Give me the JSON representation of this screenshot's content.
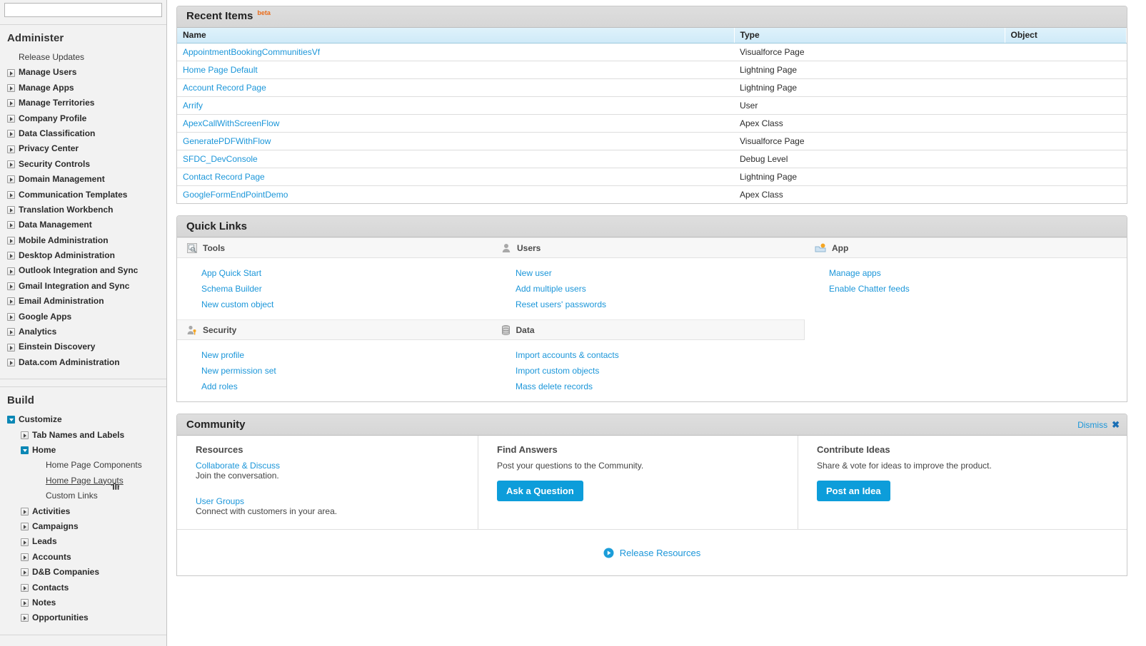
{
  "sidebar": {
    "search_placeholder": "",
    "administer": {
      "title": "Administer",
      "items": [
        {
          "label": "Release Updates",
          "state": "leaf"
        },
        {
          "label": "Manage Users",
          "state": "closed"
        },
        {
          "label": "Manage Apps",
          "state": "closed"
        },
        {
          "label": "Manage Territories",
          "state": "closed"
        },
        {
          "label": "Company Profile",
          "state": "closed"
        },
        {
          "label": "Data Classification",
          "state": "closed"
        },
        {
          "label": "Privacy Center",
          "state": "closed"
        },
        {
          "label": "Security Controls",
          "state": "closed"
        },
        {
          "label": "Domain Management",
          "state": "closed"
        },
        {
          "label": "Communication Templates",
          "state": "closed"
        },
        {
          "label": "Translation Workbench",
          "state": "closed"
        },
        {
          "label": "Data Management",
          "state": "closed"
        },
        {
          "label": "Mobile Administration",
          "state": "closed"
        },
        {
          "label": "Desktop Administration",
          "state": "closed"
        },
        {
          "label": "Outlook Integration and Sync",
          "state": "closed"
        },
        {
          "label": "Gmail Integration and Sync",
          "state": "closed"
        },
        {
          "label": "Email Administration",
          "state": "closed"
        },
        {
          "label": "Google Apps",
          "state": "closed"
        },
        {
          "label": "Analytics",
          "state": "closed"
        },
        {
          "label": "Einstein Discovery",
          "state": "closed"
        },
        {
          "label": "Data.com Administration",
          "state": "closed"
        }
      ]
    },
    "build": {
      "title": "Build",
      "items": [
        {
          "label": "Customize",
          "state": "open",
          "level": 1
        },
        {
          "label": "Tab Names and Labels",
          "state": "closed",
          "level": 2
        },
        {
          "label": "Home",
          "state": "open",
          "level": 2
        },
        {
          "label": "Home Page Components",
          "state": "leaf",
          "level": 3
        },
        {
          "label": "Home Page Layouts",
          "state": "leaf",
          "level": 3,
          "selected": true
        },
        {
          "label": "Custom Links",
          "state": "leaf",
          "level": 3
        },
        {
          "label": "Activities",
          "state": "closed",
          "level": 2
        },
        {
          "label": "Campaigns",
          "state": "closed",
          "level": 2
        },
        {
          "label": "Leads",
          "state": "closed",
          "level": 2
        },
        {
          "label": "Accounts",
          "state": "closed",
          "level": 2
        },
        {
          "label": "D&B Companies",
          "state": "closed",
          "level": 2
        },
        {
          "label": "Contacts",
          "state": "closed",
          "level": 2
        },
        {
          "label": "Notes",
          "state": "closed",
          "level": 2
        },
        {
          "label": "Opportunities",
          "state": "closed",
          "level": 2
        }
      ]
    }
  },
  "recent_items": {
    "title": "Recent Items",
    "badge": "beta",
    "columns": [
      "Name",
      "Type",
      "Object"
    ],
    "rows": [
      {
        "name": "AppointmentBookingCommunitiesVf",
        "type": "Visualforce Page",
        "object": ""
      },
      {
        "name": "Home Page Default",
        "type": "Lightning Page",
        "object": ""
      },
      {
        "name": "Account Record Page",
        "type": "Lightning Page",
        "object": ""
      },
      {
        "name": "Arrify",
        "type": "User",
        "object": ""
      },
      {
        "name": "ApexCallWithScreenFlow",
        "type": "Apex Class",
        "object": ""
      },
      {
        "name": "GeneratePDFWithFlow",
        "type": "Visualforce Page",
        "object": ""
      },
      {
        "name": "SFDC_DevConsole",
        "type": "Debug Level",
        "object": ""
      },
      {
        "name": "Contact Record Page",
        "type": "Lightning Page",
        "object": ""
      },
      {
        "name": "GoogleFormEndPointDemo",
        "type": "Apex Class",
        "object": ""
      }
    ]
  },
  "quick_links": {
    "title": "Quick Links",
    "sections": [
      {
        "heading": "Tools",
        "icon": "tools-icon",
        "links": [
          "App Quick Start",
          "Schema Builder",
          "New custom object"
        ]
      },
      {
        "heading": "Users",
        "icon": "user-icon",
        "links": [
          "New user",
          "Add multiple users",
          "Reset users' passwords"
        ]
      },
      {
        "heading": "App",
        "icon": "app-icon",
        "links": [
          "Manage apps",
          "Enable Chatter feeds"
        ]
      },
      {
        "heading": "Security",
        "icon": "security-key-icon",
        "links": [
          "New profile",
          "New permission set",
          "Add roles"
        ]
      },
      {
        "heading": "Data",
        "icon": "database-icon",
        "links": [
          "Import accounts & contacts",
          "Import custom objects",
          "Mass delete records"
        ]
      }
    ]
  },
  "community": {
    "title": "Community",
    "dismiss_label": "Dismiss",
    "columns": [
      {
        "heading": "Resources",
        "links": [
          {
            "label": "Collaborate & Discuss",
            "desc": "Join the conversation."
          },
          {
            "label": "User Groups",
            "desc": "Connect with customers in your area."
          }
        ]
      },
      {
        "heading": "Find Answers",
        "desc": "Post your questions to the Community.",
        "button": "Ask a Question"
      },
      {
        "heading": "Contribute Ideas",
        "desc": "Share & vote for ideas to improve the product.",
        "button": "Post an Idea"
      }
    ],
    "footer_link": "Release Resources"
  },
  "colors": {
    "link": "#1b96d9",
    "button": "#0d9dda",
    "beta": "#ea6b18",
    "tree_open": "#0b87b5",
    "table_header": "#cfeaf8"
  }
}
